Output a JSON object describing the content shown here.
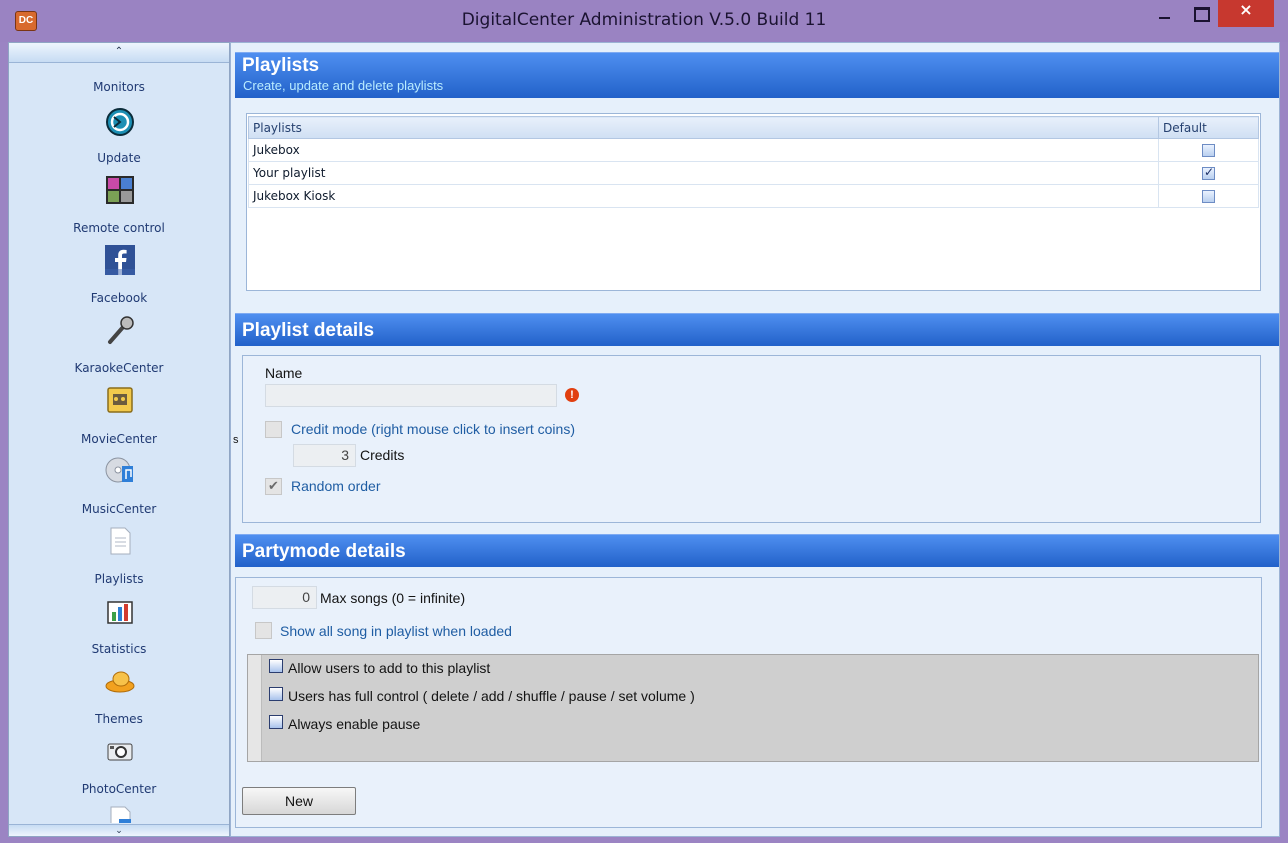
{
  "window": {
    "title": "DigitalCenter Administration V.5.0 Build 11",
    "app_icon_text": "DC",
    "minimize_icon": "minimize-icon",
    "maximize_icon": "maximize-icon",
    "close_glyph": "×"
  },
  "sidebar": {
    "scroll_up": "⌃",
    "scroll_down": "⌄",
    "items": [
      {
        "label": "Monitors",
        "icon": "monitors-icon"
      },
      {
        "label": "Update",
        "icon": "update-icon"
      },
      {
        "label": "Remote control",
        "icon": "remote-control-icon"
      },
      {
        "label": "Facebook",
        "icon": "facebook-icon"
      },
      {
        "label": "KaraokeCenter",
        "icon": "microphone-icon"
      },
      {
        "label": "MovieCenter",
        "icon": "film-icon"
      },
      {
        "label": "MusicCenter",
        "icon": "music-cd-icon"
      },
      {
        "label": "Playlists",
        "icon": "document-icon"
      },
      {
        "label": "Statistics",
        "icon": "bar-chart-icon"
      },
      {
        "label": "Themes",
        "icon": "theme-hat-icon"
      },
      {
        "label": "PhotoCenter",
        "icon": "camera-icon"
      }
    ]
  },
  "playlists_section": {
    "title": "Playlists",
    "subtitle": "Create, update and delete playlists",
    "table": {
      "columns": [
        "Playlists",
        "Default"
      ],
      "rows": [
        {
          "name": "Jukebox",
          "default": false
        },
        {
          "name": "Your playlist",
          "default": true
        },
        {
          "name": "Jukebox Kiosk",
          "default": false
        }
      ]
    }
  },
  "playlist_details": {
    "title": "Playlist details",
    "name_label": "Name",
    "name_value": "",
    "error_glyph": "!",
    "credit_mode_label": "Credit mode (right mouse click to insert coins)",
    "credit_mode_checked": false,
    "credits_value": "3",
    "credits_label": "Credits",
    "random_order_label": "Random order",
    "random_order_checked": true,
    "stray_char": "s"
  },
  "partymode_details": {
    "title": "Partymode details",
    "max_songs_value": "0",
    "max_songs_label": "Max songs (0 = infinite)",
    "show_all_label": "Show all song in playlist when loaded",
    "show_all_checked": false,
    "options": [
      {
        "label": "Allow users to add to this playlist",
        "checked": false
      },
      {
        "label": "Users has full control ( delete / add / shuffle / pause / set volume )",
        "checked": false
      },
      {
        "label": "Always enable pause",
        "checked": false
      }
    ]
  },
  "actions": {
    "new_label": "New"
  }
}
